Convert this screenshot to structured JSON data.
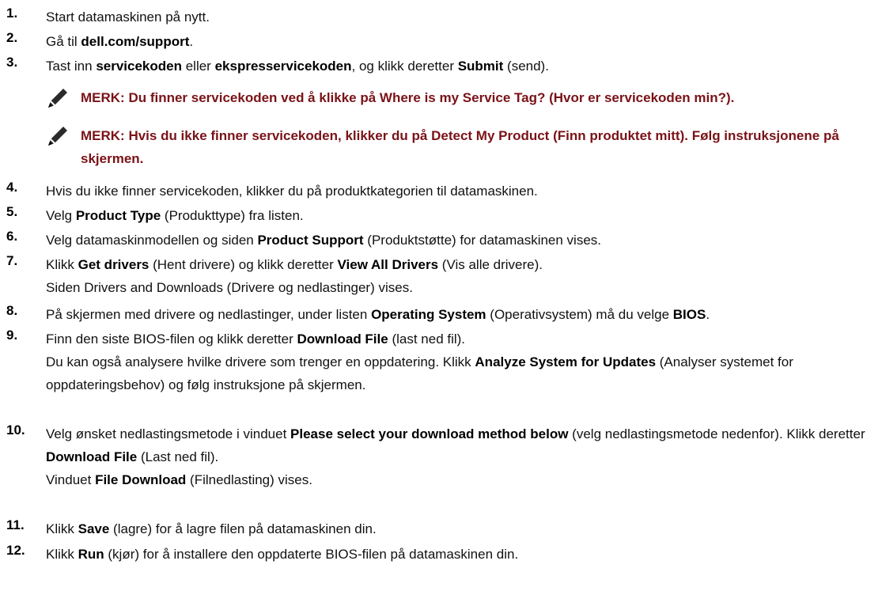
{
  "steps": [
    {
      "num": "1.",
      "parts": [
        {
          "t": "Start datamaskinen på nytt."
        }
      ]
    },
    {
      "num": "2.",
      "parts": [
        {
          "t": "Gå til "
        },
        {
          "t": "dell.com/support",
          "b": true
        },
        {
          "t": "."
        }
      ]
    },
    {
      "num": "3.",
      "parts": [
        {
          "t": "Tast inn "
        },
        {
          "t": "servicekoden",
          "b": true
        },
        {
          "t": " eller "
        },
        {
          "t": "ekspresservicekoden",
          "b": true
        },
        {
          "t": ", og klikk deretter "
        },
        {
          "t": "Submit",
          "b": true
        },
        {
          "t": " (send)."
        }
      ]
    },
    {
      "num": "4.",
      "parts": [
        {
          "t": "Hvis du ikke finner servicekoden, klikker du på produktkategorien til datamaskinen."
        }
      ]
    },
    {
      "num": "5.",
      "parts": [
        {
          "t": "Velg "
        },
        {
          "t": "Product Type",
          "b": true
        },
        {
          "t": " (Produkttype) fra listen."
        }
      ]
    },
    {
      "num": "6.",
      "parts": [
        {
          "t": "Velg datamaskinmodellen og siden "
        },
        {
          "t": "Product Support",
          "b": true
        },
        {
          "t": " (Produktstøtte) for datamaskinen vises."
        }
      ]
    },
    {
      "num": "7.",
      "parts": [
        {
          "t": "Klikk "
        },
        {
          "t": "Get drivers",
          "b": true
        },
        {
          "t": " (Hent drivere) og klikk deretter "
        },
        {
          "t": "View All Drivers",
          "b": true
        },
        {
          "t": " (Vis alle drivere)."
        }
      ],
      "extra": [
        "Siden Drivers and Downloads (Drivere og nedlastinger) vises."
      ]
    },
    {
      "num": "8.",
      "parts": [
        {
          "t": "På skjermen med drivere og nedlastinger, under listen "
        },
        {
          "t": "Operating System",
          "b": true
        },
        {
          "t": " (Operativsystem) må du velge "
        },
        {
          "t": "BIOS",
          "b": true
        },
        {
          "t": "."
        }
      ]
    },
    {
      "num": "9.",
      "parts": [
        {
          "t": "Finn den siste BIOS-filen og klikk deretter "
        },
        {
          "t": "Download File",
          "b": true
        },
        {
          "t": " (last ned fil)."
        }
      ],
      "extra_rich": [
        {
          "t": "Du kan også analysere hvilke drivere som trenger en oppdatering. Klikk "
        },
        {
          "t": "Analyze System for Updates",
          "b": true
        },
        {
          "t": " (Analyser systemet for oppdateringsbehov) og følg instruksjone på skjermen."
        }
      ]
    },
    {
      "num": "10.",
      "parts": [
        {
          "t": "Velg ønsket nedlastingsmetode i vinduet "
        },
        {
          "t": "Please select your download method below",
          "b": true
        },
        {
          "t": " (velg nedlastingsmetode nedenfor). Klikk deretter "
        },
        {
          "t": "Download File",
          "b": true
        },
        {
          "t": " (Last ned fil)."
        }
      ],
      "extra_rich": [
        {
          "t": "Vinduet "
        },
        {
          "t": "File Download",
          "b": true
        },
        {
          "t": " (Filnedlasting) vises."
        }
      ]
    },
    {
      "num": "11.",
      "parts": [
        {
          "t": "Klikk "
        },
        {
          "t": "Save",
          "b": true
        },
        {
          "t": " (lagre) for å lagre filen på datamaskinen din."
        }
      ]
    },
    {
      "num": "12.",
      "parts": [
        {
          "t": "Klikk "
        },
        {
          "t": "Run",
          "b": true
        },
        {
          "t": " (kjør) for å installere den oppdaterte BIOS-filen på datamaskinen din."
        }
      ]
    }
  ],
  "notes": [
    {
      "icon": "note-pencil-icon",
      "text": "MERK: Du finner servicekoden ved å klikke på Where is my Service Tag? (Hvor er servicekoden min?)."
    },
    {
      "icon": "note-pencil-icon",
      "text": "MERK: Hvis du ikke finner servicekoden, klikker du på Detect My Product (Finn produktet mitt). Følg instruksjonene på skjermen."
    }
  ],
  "colors": {
    "note_text": "#7a1217",
    "body_text": "#111111"
  }
}
